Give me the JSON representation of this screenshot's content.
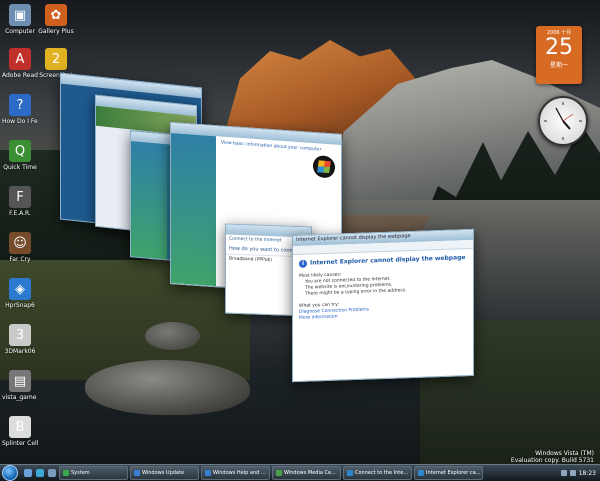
{
  "desktop_icons": [
    {
      "name": "computer-icon",
      "label": "Computer",
      "color": "#6c8fb1",
      "glyph": "▣"
    },
    {
      "name": "gallery-icon",
      "label": "Gallery Plus",
      "color": "#d06020",
      "glyph": "✿"
    },
    {
      "name": "adobe-reader-icon",
      "label": "Adobe Reader",
      "color": "#c0302a",
      "glyph": "A"
    },
    {
      "name": "screenshot-icon",
      "label": "Screenshot",
      "color": "#e1b322",
      "glyph": "2"
    },
    {
      "name": "help-icon",
      "label": "How Do I Feedback",
      "color": "#2d6bc8",
      "glyph": "?"
    },
    {
      "name": "quicktime-icon",
      "label": "Quick Time",
      "color": "#3a8e34",
      "glyph": "Q"
    },
    {
      "name": "fear-icon",
      "label": "F.E.A.R.",
      "color": "#555",
      "glyph": "F"
    },
    {
      "name": "farcry-icon",
      "label": "Far Cry",
      "color": "#754b2c",
      "glyph": "☺"
    },
    {
      "name": "hypersnap-icon",
      "label": "HprSnap6",
      "color": "#2b7acf",
      "glyph": "◈"
    },
    {
      "name": "3dmark-icon",
      "label": "3DMark06",
      "color": "#c9c9c9",
      "glyph": "3"
    },
    {
      "name": "vista-game-icon",
      "label": "vista_game Shortcut",
      "color": "#777",
      "glyph": "▤"
    },
    {
      "name": "bench-icon",
      "label": "Splinter Cell Chaos Th...",
      "color": "#ddd",
      "glyph": "B"
    }
  ],
  "calendar": {
    "month": "2006 十月",
    "day": "25",
    "weekday": "星期一"
  },
  "ie_window": {
    "title": "Internet Explorer cannot display the webpage",
    "heading": "Internet Explorer cannot display the webpage",
    "what_label": "Most likely causes:",
    "causes": [
      "You are not connected to the Internet.",
      "The website is encountering problems.",
      "There might be a typing error in the address."
    ],
    "try_label": "What you can try:",
    "links": [
      "Diagnose Connection Problems",
      "More information"
    ]
  },
  "connect_window": {
    "title": "Connect to the Internet",
    "heading": "How do you want to connect?",
    "option": "Broadband (PPPoE)"
  },
  "watermark": [
    "Windows Vista (TM)",
    "Evaluation copy. Build 5731"
  ],
  "taskbar": {
    "tasks": [
      {
        "label": "System",
        "color": "#3aa94d"
      },
      {
        "label": "Windows Update",
        "color": "#3a7fd6"
      },
      {
        "label": "Windows Help and ...",
        "color": "#3a7fd6"
      },
      {
        "label": "Windows Media Ce...",
        "color": "#48a047"
      },
      {
        "label": "Connect to the Inte...",
        "color": "#2d86c7"
      },
      {
        "label": "Internet Explorer ca...",
        "color": "#2d86c7"
      }
    ],
    "clock": "18:23"
  }
}
